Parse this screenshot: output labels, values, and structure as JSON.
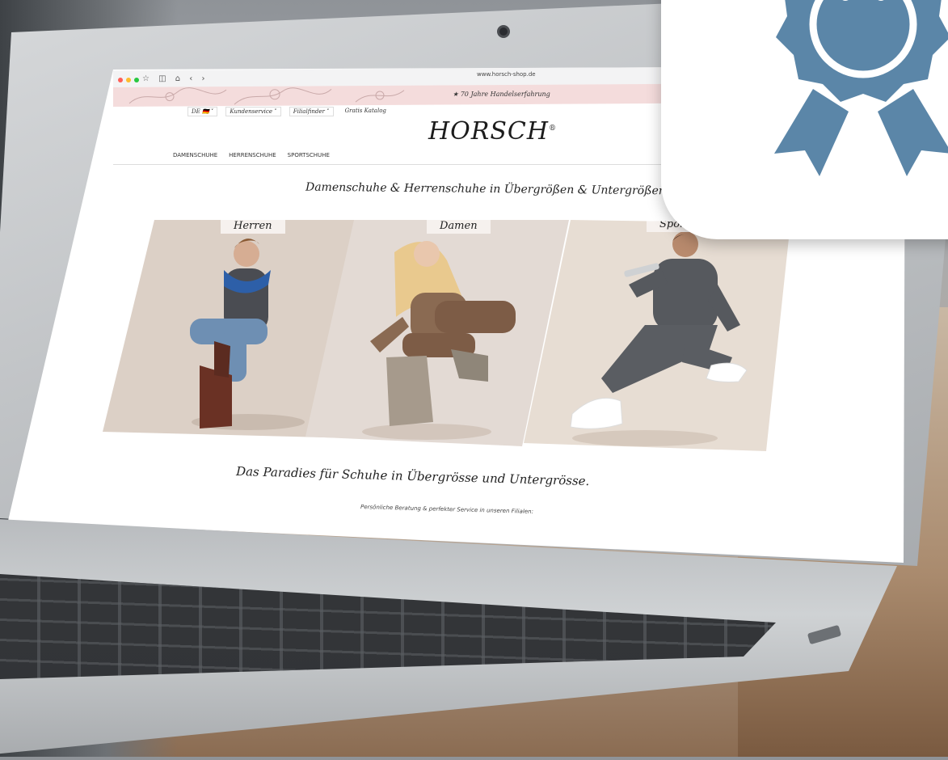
{
  "browser": {
    "url": "www.horsch-shop.de",
    "toolbar_icons": "☆ ◫ ⌂ ‹ ›"
  },
  "promo": {
    "star": "★",
    "text": "70 Jahre Handelserfahrung"
  },
  "nav": {
    "country": "DE",
    "flag": "🇩🇪",
    "kundenservice": "Kundenservice",
    "filialfinder": "Filialfinder",
    "katalog": "Gratis Katalog",
    "chevron": "˅"
  },
  "logo": "HORSCH",
  "logo_mark": "®",
  "categories": [
    "DAMENSCHUHE",
    "HERRENSCHUHE",
    "SPORTSCHUHE"
  ],
  "headline": "Damenschuhe & Herrenschuhe in Übergrößen & Untergrößen",
  "panels": [
    {
      "label": "Herren"
    },
    {
      "label": "Damen"
    },
    {
      "label": "Sport"
    }
  ],
  "tagline": "Das Paradies für Schuhe in Übergrösse und Untergrösse.",
  "subtagline": "Persönliche Beratung & perfekter Service in unseren Filialen:",
  "colors": {
    "badge_blue": "#5b86a8",
    "promo_pink": "#f4dcdc"
  },
  "icons": {
    "badge": "award-ribbon-icon"
  }
}
